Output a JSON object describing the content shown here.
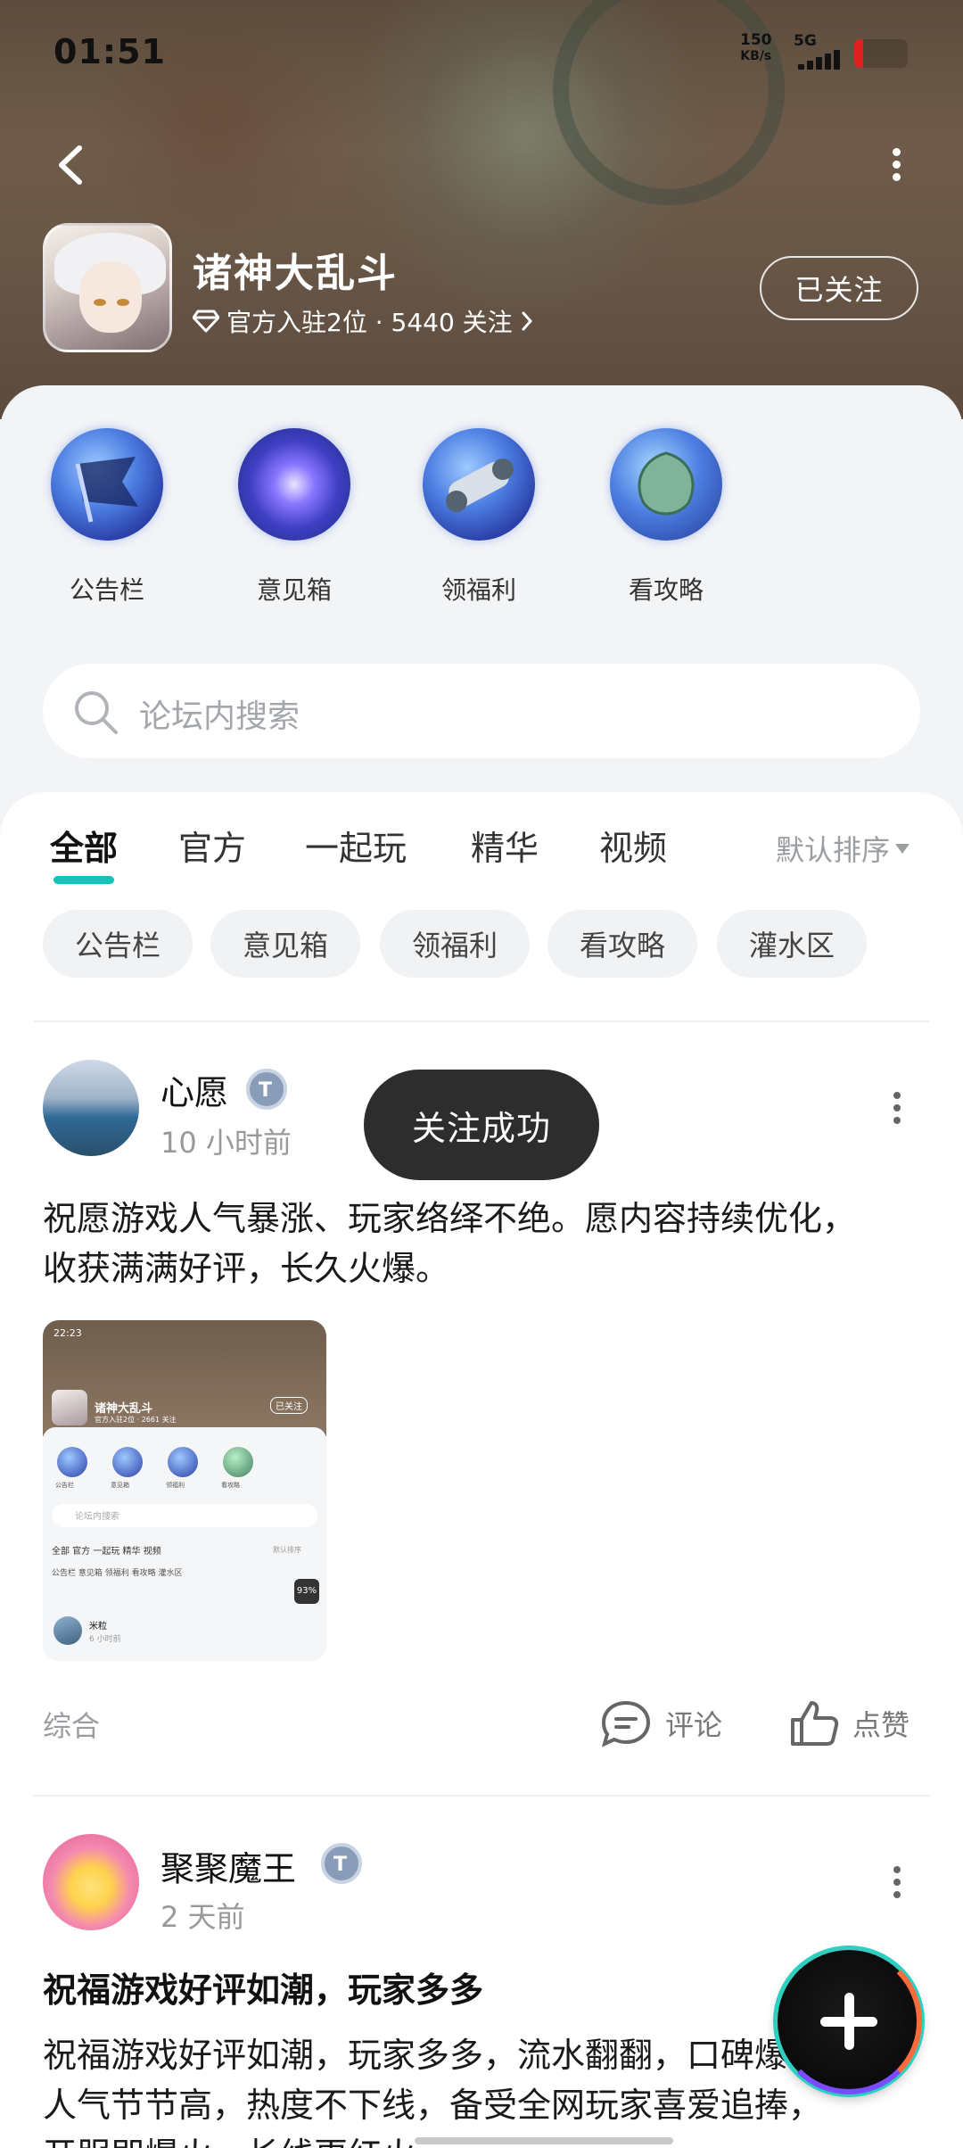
{
  "status_bar": {
    "time": "01:51",
    "speed_value": "150",
    "speed_unit": "KB/s",
    "network": "5G",
    "battery_color": "#e01f1f"
  },
  "header": {
    "game_name": "诸神大乱斗",
    "meta": "官方入驻2位 · 5440 关注",
    "follow_label": "已关注",
    "icons": [
      "back-arrow-icon",
      "more-vertical-icon",
      "diamond-icon",
      "chevron-right-icon"
    ]
  },
  "quick_entries": [
    {
      "label": "公告栏",
      "icon": "bulletin-flag-icon"
    },
    {
      "label": "意见箱",
      "icon": "galaxy-orb-icon"
    },
    {
      "label": "领福利",
      "icon": "scroll-icon"
    },
    {
      "label": "看攻略",
      "icon": "jade-leaf-icon"
    }
  ],
  "search": {
    "placeholder": "论坛内搜索"
  },
  "tabs": [
    "全部",
    "官方",
    "一起玩",
    "精华",
    "视频"
  ],
  "sort_label": "默认排序",
  "chips": [
    "公告栏",
    "意见箱",
    "领福利",
    "看攻略",
    "灌水区"
  ],
  "posts": [
    {
      "author": "心愿",
      "time": "10 小时前",
      "text_line1": "祝愿游戏人气暴涨、玩家络绎不绝。愿内容持续优化，",
      "text_line2": "收获满满好评，长久火爆。",
      "category": "综合",
      "comment_label": "评论",
      "like_label": "点赞",
      "thumbnail": {
        "time": "22:23",
        "game_name": "诸神大乱斗",
        "follow": "已关注",
        "meta": "官方入驻2位 · 2661 关注",
        "search": "论坛内搜索",
        "tabs": "全部  官方  一起玩  精华  视频",
        "chips": "公告栏  意见箱  领福利  看攻略  灌水区",
        "sort": "默认排序",
        "pct": "93%",
        "author": "米粒",
        "time_ago": "6 小时前",
        "quick": [
          "公告栏",
          "意见箱",
          "领福利",
          "看攻略"
        ]
      }
    },
    {
      "author": "聚聚魔王",
      "time": "2 天前",
      "title": "祝福游戏好评如潮，玩家多多",
      "text_line1": "祝福游戏好评如潮，玩家多多，流水翻翻，口碑爆棚，",
      "text_line2": "人气节节高，热度不下线，备受全网玩家喜爱追捧，",
      "text_line3": "开服即爆火，长线更红火。"
    }
  ],
  "toast": "关注成功",
  "fab": {
    "icon": "plus-icon"
  },
  "colors": {
    "accent": "#16c2b8",
    "toast_bg": "#2d2d2d"
  }
}
